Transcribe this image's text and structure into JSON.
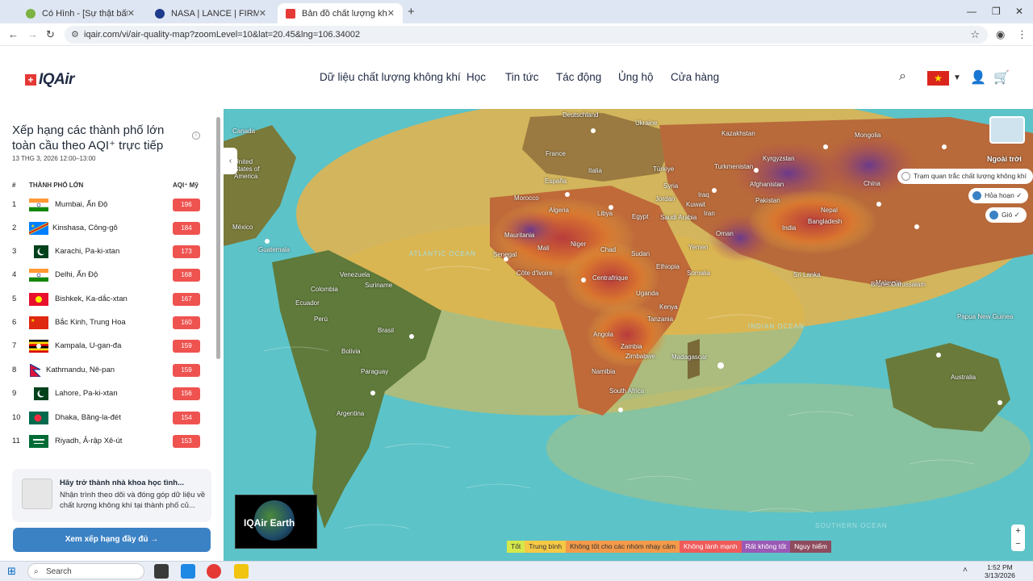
{
  "browser": {
    "tabs": [
      {
        "title": "Có Hình - [Sự thật bất ngờ] Chi"
      },
      {
        "title": "NASA | LANCE | FIRMS"
      },
      {
        "title": "Bản đồ chất lượng không khí ở"
      }
    ],
    "url": "iqair.com/vi/air-quality-map?zoomLevel=10&lat=20.45&lng=106.34002"
  },
  "header": {
    "brand": "IQAir",
    "menu": [
      "Dữ liệu chất lượng không khí",
      "Học",
      "Tin tức",
      "Tác động",
      "Ủng hộ",
      "Cửa hàng"
    ]
  },
  "sidebar": {
    "title": "Xếp hạng các thành phố lớn toàn cầu theo AQI⁺ trực tiếp",
    "date": "13 THG 3, 2026 12:00–13:00",
    "col_rank": "#",
    "col_city": "THÀNH PHỐ LỚN",
    "col_aqi": "AQI⁺ Mỹ",
    "rows": [
      {
        "rank": "1",
        "city": "Mumbai, Ấn Độ",
        "aqi": "196",
        "flag": "india"
      },
      {
        "rank": "2",
        "city": "Kinshasa, Công-gô",
        "aqi": "184",
        "flag": "drc"
      },
      {
        "rank": "3",
        "city": "Karachi, Pa-ki-xtan",
        "aqi": "173",
        "flag": "pakistan"
      },
      {
        "rank": "4",
        "city": "Delhi, Ấn Độ",
        "aqi": "168",
        "flag": "india"
      },
      {
        "rank": "5",
        "city": "Bishkek, Ka-dắc-xtan",
        "aqi": "167",
        "flag": "kyrgyzstan"
      },
      {
        "rank": "6",
        "city": "Bắc Kinh, Trung Hoa",
        "aqi": "160",
        "flag": "china"
      },
      {
        "rank": "7",
        "city": "Kampala, U-gan-đa",
        "aqi": "159",
        "flag": "uganda"
      },
      {
        "rank": "8",
        "city": "Kathmandu, Nê-pan",
        "aqi": "159",
        "flag": "nepal"
      },
      {
        "rank": "9",
        "city": "Lahore, Pa-ki-xtan",
        "aqi": "156",
        "flag": "pakistan"
      },
      {
        "rank": "10",
        "city": "Dhaka, Băng-la-đét",
        "aqi": "154",
        "flag": "bangladesh"
      },
      {
        "rank": "11",
        "city": "Riyadh, Ả-rập Xê-út",
        "aqi": "153",
        "flag": "saudi"
      }
    ],
    "card_title": "Hãy trở thành nhà khoa học tình...",
    "card_text": "Nhận trình theo dõi và đóng góp dữ liệu về chất lượng không khí tại thành phố củ...",
    "full_button": "Xem xếp hạng đầy đủ →"
  },
  "map": {
    "layer_label": "Ngoài trời",
    "station_pill": "Trạm quan trắc chất lượng không khí",
    "fire_pill": "Hỏa hoạn ✓",
    "wind_pill": "Gió ✓",
    "earth_label": "IQAir Earth",
    "legend": [
      {
        "label": "Tốt",
        "color": "#d4e84b"
      },
      {
        "label": "Trung bình",
        "color": "#f6c945"
      },
      {
        "label": "Không tốt cho các nhóm nhạy cảm",
        "color": "#f39a4a"
      },
      {
        "label": "Không lành mạnh",
        "color": "#ef5a5a"
      },
      {
        "label": "Rất không tốt",
        "color": "#9b59b6"
      },
      {
        "label": "Nguy hiểm",
        "color": "#8e4b5e"
      }
    ],
    "places": [
      {
        "name": "Deutschland"
      },
      {
        "name": "Ukraine"
      },
      {
        "name": "France"
      },
      {
        "name": "España"
      },
      {
        "name": "Italia"
      },
      {
        "name": "Türkiye"
      },
      {
        "name": "Kazakhstan"
      },
      {
        "name": "Mongolia"
      },
      {
        "name": "Turkmenistan"
      },
      {
        "name": "Kyrgyzstan"
      },
      {
        "name": "Afghanistan"
      },
      {
        "name": "China"
      },
      {
        "name": "Pakistan"
      },
      {
        "name": "Nepal"
      },
      {
        "name": "India"
      },
      {
        "name": "Bangladesh"
      },
      {
        "name": "Iraq"
      },
      {
        "name": "Iran"
      },
      {
        "name": "Syria"
      },
      {
        "name": "Jordan"
      },
      {
        "name": "Kuwait"
      },
      {
        "name": "Egypt"
      },
      {
        "name": "Libya"
      },
      {
        "name": "Algeria"
      },
      {
        "name": "Morocco"
      },
      {
        "name": "Mauritania"
      },
      {
        "name": "Mali"
      },
      {
        "name": "Niger"
      },
      {
        "name": "Chad"
      },
      {
        "name": "Sudan"
      },
      {
        "name": "Saudi Arabia"
      },
      {
        "name": "Yemen"
      },
      {
        "name": "Oman"
      },
      {
        "name": "Ethiopia"
      },
      {
        "name": "Somalia"
      },
      {
        "name": "Senegal"
      },
      {
        "name": "Côte d'Ivoire"
      },
      {
        "name": "Centrafrique"
      },
      {
        "name": "Uganda"
      },
      {
        "name": "Kenya"
      },
      {
        "name": "Tanzania"
      },
      {
        "name": "Angola"
      },
      {
        "name": "Zambia"
      },
      {
        "name": "Zimbabwe"
      },
      {
        "name": "Namibia"
      },
      {
        "name": "South Africa"
      },
      {
        "name": "Madagascar"
      },
      {
        "name": "México"
      },
      {
        "name": "Guatemala"
      },
      {
        "name": "Colombia"
      },
      {
        "name": "Venezuela"
      },
      {
        "name": "Ecuador"
      },
      {
        "name": "Perú"
      },
      {
        "name": "Brasil"
      },
      {
        "name": "Bolivia"
      },
      {
        "name": "Paraguay"
      },
      {
        "name": "Argentina"
      },
      {
        "name": "Suriname"
      },
      {
        "name": "Sri Lanka"
      },
      {
        "name": "Malaysia"
      },
      {
        "name": "Brunei Darussalam"
      },
      {
        "name": "Papua New Guinea"
      },
      {
        "name": "Australia"
      },
      {
        "name": "Canada"
      },
      {
        "name": "United States of America"
      }
    ],
    "oceans": [
      {
        "name": "ATLANTIC OCEAN"
      },
      {
        "name": "INDIAN OCEAN"
      },
      {
        "name": "SOUTHERN OCEAN"
      }
    ]
  },
  "taskbar": {
    "search": "Search",
    "time": "1:52 PM",
    "date": "3/13/2026"
  }
}
